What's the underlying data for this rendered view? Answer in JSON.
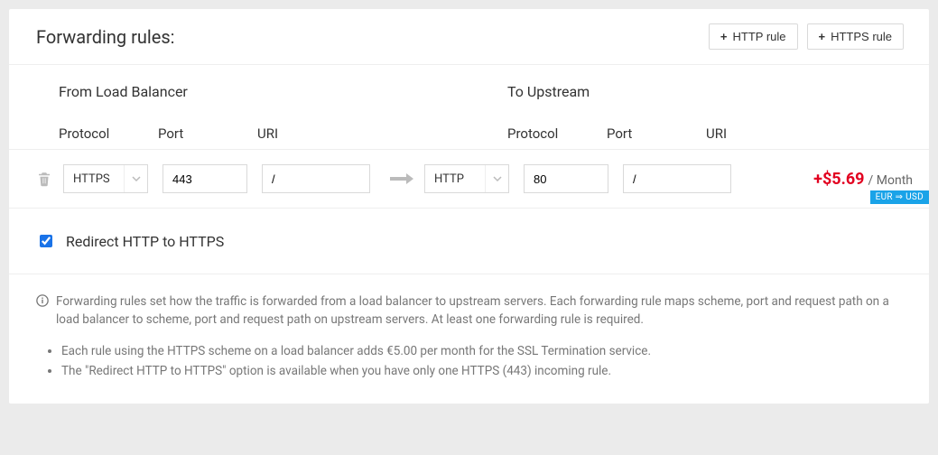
{
  "header": {
    "title": "Forwarding rules:",
    "http_btn": "HTTP rule",
    "https_btn": "HTTPS rule"
  },
  "columns": {
    "from_title": "From Load Balancer",
    "to_title": "To Upstream",
    "protocol": "Protocol",
    "port": "Port",
    "uri": "URI"
  },
  "rule": {
    "from_protocol": "HTTPS",
    "from_port": "443",
    "from_uri": "/",
    "to_protocol": "HTTP",
    "to_port": "80",
    "to_uri": "/",
    "price": "+$5.69",
    "price_suffix": "/ Month",
    "currency_badge": "EUR ⇒ USD"
  },
  "redirect": {
    "label": "Redirect HTTP to HTTPS",
    "checked": true
  },
  "info": {
    "lead": "Forwarding rules set how the traffic is forwarded from a load balancer to upstream servers. Each forwarding rule maps scheme, port and request path on a load balancer to scheme, port and request path on upstream servers. At least one forwarding rule is required.",
    "bullet1": "Each rule using the HTTPS scheme on a load balancer adds €5.00 per month for the SSL Termination service.",
    "bullet2": "The \"Redirect HTTP to HTTPS\" option is available when you have only one HTTPS (443) incoming rule."
  }
}
